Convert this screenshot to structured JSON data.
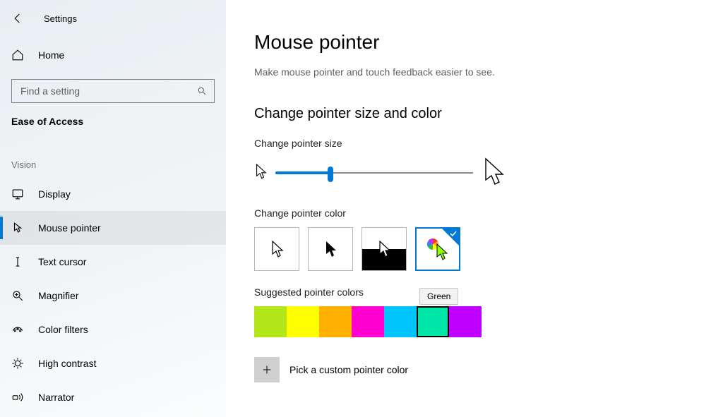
{
  "app_title": "Settings",
  "home_label": "Home",
  "search": {
    "placeholder": "Find a setting"
  },
  "category": "Ease of Access",
  "group_label": "Vision",
  "nav": [
    {
      "key": "display",
      "label": "Display"
    },
    {
      "key": "mouse-pointer",
      "label": "Mouse pointer",
      "selected": true
    },
    {
      "key": "text-cursor",
      "label": "Text cursor"
    },
    {
      "key": "magnifier",
      "label": "Magnifier"
    },
    {
      "key": "color-filters",
      "label": "Color filters"
    },
    {
      "key": "high-contrast",
      "label": "High contrast"
    },
    {
      "key": "narrator",
      "label": "Narrator"
    }
  ],
  "page": {
    "title": "Mouse pointer",
    "subtitle": "Make mouse pointer and touch feedback easier to see.",
    "section_title": "Change pointer size and color",
    "size_label": "Change pointer size",
    "slider_percent": 28,
    "color_label": "Change pointer color",
    "color_options": [
      {
        "key": "white",
        "selected": false
      },
      {
        "key": "black",
        "selected": false
      },
      {
        "key": "inverted",
        "selected": false
      },
      {
        "key": "custom",
        "selected": true
      }
    ],
    "swatch_label": "Suggested pointer colors",
    "swatches": [
      {
        "name": "Lime",
        "hex": "#b3e61a",
        "selected": false
      },
      {
        "name": "Yellow",
        "hex": "#ffff00",
        "selected": false
      },
      {
        "name": "Orange",
        "hex": "#ffb000",
        "selected": false
      },
      {
        "name": "Pink",
        "hex": "#ff00d1",
        "selected": false
      },
      {
        "name": "Cyan",
        "hex": "#00c5ff",
        "selected": false
      },
      {
        "name": "Green",
        "hex": "#00e6a8",
        "selected": true
      },
      {
        "name": "Purple",
        "hex": "#bf00ff",
        "selected": false
      }
    ],
    "tooltip": "Green",
    "custom_label": "Pick a custom pointer color"
  }
}
